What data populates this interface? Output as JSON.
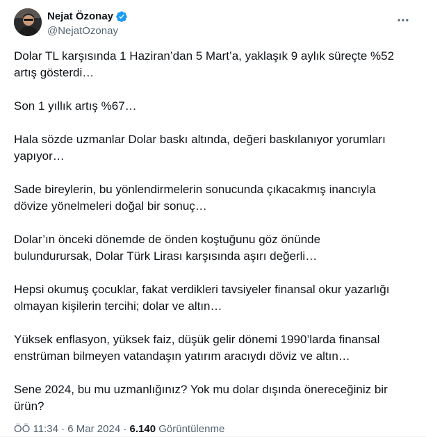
{
  "author": {
    "display_name": "Nejat Özonay",
    "handle": "@NejatOzonay",
    "verified": true,
    "verified_color": "#1d9bf0",
    "avatar_icon": "user-avatar-photo"
  },
  "menu": {
    "more_icon": "more-horizontal-icon"
  },
  "tweet": {
    "paragraphs": [
      "Dolar TL karşısında 1 Haziran’dan 5 Mart’a, yaklaşık 9 aylık süreçte %52\nartış gösterdi…",
      "Son 1 yıllık artış %67…",
      "Hala sözde uzmanlar Dolar baskı altında, değeri baskılanıyor yorumları\nyapıyor…",
      "Sade bireylerin, bu yönlendirmelerin sonucunda çıkacakmış inancıyla\ndövize yönelmeleri doğal bir sonuç…",
      "Dolar’ın önceki dönemde de önden koştuğunu göz önünde\nbulundurursak, Dolar Türk Lirası karşısında aşırı değerli…",
      "Hepsi okumuş çocuklar, fakat verdikleri tavsiyeler finansal okur yazarlığı\nolmayan kişilerin tercihi; dolar ve altın…",
      "Yüksek enflasyon, yüksek faiz, düşük gelir dönemi 1990’larda finansal\nenstrüman bilmeyen vatandaşın yatırım aracıydı döviz ve altın…",
      "Sene 2024, bu mu uzmanlığınız? Yok mu dolar dışında önereceğiniz bir\nürün?"
    ]
  },
  "meta": {
    "time": "ÖÖ 11:34",
    "separator": "·",
    "date": "6 Mar 2024",
    "views_count": "6.140",
    "views_label": "Görüntülenme"
  }
}
